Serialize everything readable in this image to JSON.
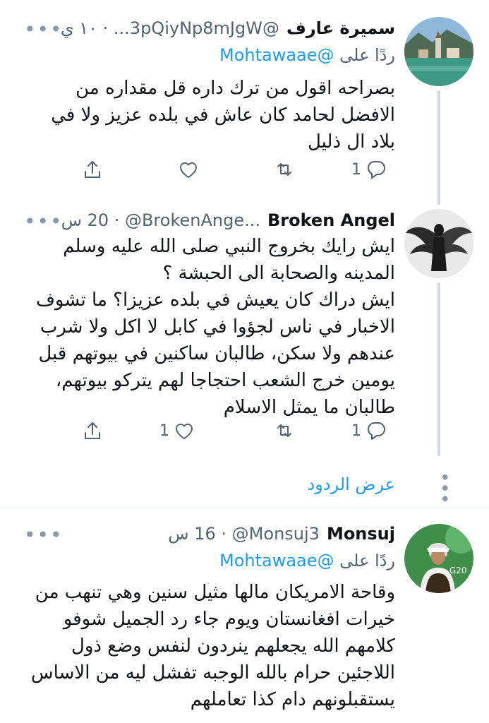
{
  "tweets": [
    {
      "name": "سميرة عارف",
      "handle": "@3pQiyNp8mJgW...",
      "time": "١٠ ي",
      "replying_prefix": "ردًا على",
      "replying_to": "@Mohtawaae",
      "text": "بصراحه اقول من ترك داره قل مقداره  من الافضل لحامد كان عاش في بلده عزيز ولا في بلاد ال ذليل",
      "reply_count": "1",
      "retweet_count": "",
      "like_count": "",
      "avatar_icon": "lake-village-avatar"
    },
    {
      "name": "Broken Angel",
      "handle": "@BrokenAnge...",
      "time": "20 س",
      "text_lines": [
        "ايش رايك بخروج النبي صلى الله عليه وسلم المدينه والصحابة الى الحبشة ؟",
        "ايش دراك كان يعيش في بلده عزيزا؟ ما تشوف الاخبار في ناس لجؤوا في كابل لا اكل ولا شرب عندهم ولا سكن، طالبان ساكنين في بيوتهم قبل يومين خرج الشعب احتجاجا لهم يتركو بيوتهم، طالبان ما يمثل الاسلام"
      ],
      "reply_count": "1",
      "retweet_count": "",
      "like_count": "1",
      "avatar_icon": "winged-angel-avatar"
    },
    {
      "name": "Monsuj",
      "handle": "@Monsuj3",
      "time": "16 س",
      "replying_prefix": "ردًا على",
      "replying_to": "@Mohtawaae",
      "text": "وقاحة الامريكان مالها مثيل سنين وهي تنهب من خيرات افغانستان ويوم جاء رد الجميل شوفو كلامهم الله يجعلهم ينردون لنفس وضع ذول اللاجئين حرام بالله الوجبه تفشل ليه من الاساس يستقبلونهم دام كذا تعاملهم",
      "avatar_icon": "g20-portrait-avatar"
    }
  ],
  "show_replies_label": "عرض الردود",
  "colors": {
    "accent": "#1d9bf0",
    "secondary": "#536471",
    "line": "#cfd9de"
  }
}
